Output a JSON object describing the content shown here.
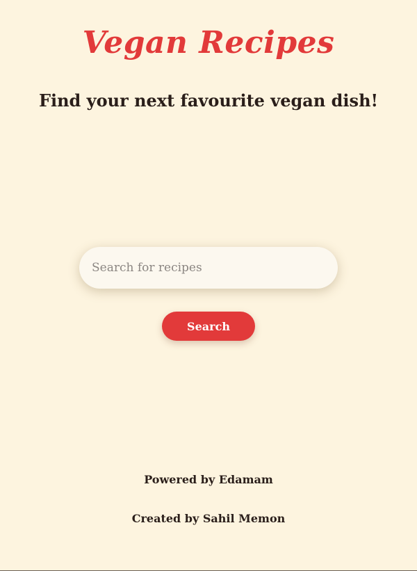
{
  "header": {
    "title": "Vegan Recipes",
    "subtitle": "Find your next favourite vegan dish!"
  },
  "search": {
    "placeholder": "Search for recipes",
    "value": "",
    "button_label": "Search"
  },
  "footer": {
    "powered_by": "Powered by Edamam",
    "created_by": "Created by Sahil Memon"
  },
  "colors": {
    "background": "#fdf4df",
    "accent": "#e23a3a",
    "text": "#2a1e1a",
    "input_background": "#fcf8ef"
  }
}
